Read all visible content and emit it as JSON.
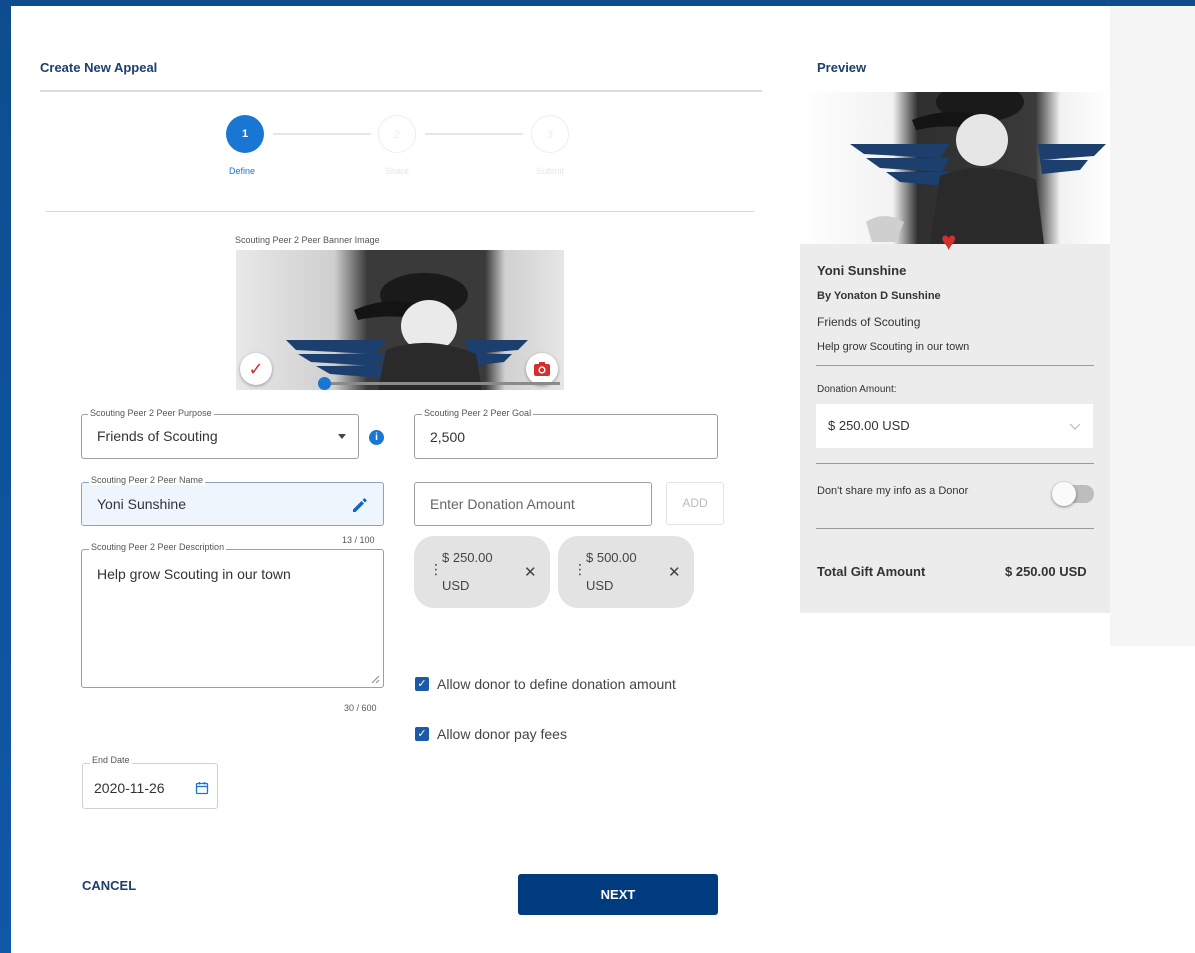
{
  "form": {
    "title": "Create New Appeal",
    "steps": [
      {
        "number": "1",
        "label": "Define",
        "active": true
      },
      {
        "number": "2",
        "label": "Share",
        "active": false
      },
      {
        "number": "3",
        "label": "Submit",
        "active": false
      }
    ],
    "banner": {
      "label": "Scouting Peer 2 Peer Banner Image"
    },
    "purpose": {
      "label": "Scouting Peer 2 Peer Purpose",
      "value": "Friends of Scouting"
    },
    "goal": {
      "label": "Scouting Peer 2 Peer Goal",
      "value": "2,500"
    },
    "name": {
      "label": "Scouting Peer 2 Peer Name",
      "value": "Yoni Sunshine",
      "counter": "13 / 100"
    },
    "description": {
      "label": "Scouting Peer 2 Peer Description",
      "value": "Help grow Scouting in our town",
      "counter": "30 / 600"
    },
    "donation_input": {
      "placeholder": "Enter Donation Amount",
      "add_label": "ADD"
    },
    "chips": [
      {
        "amount": "$ 250.00",
        "currency": "USD"
      },
      {
        "amount": "$ 500.00",
        "currency": "USD"
      }
    ],
    "checkboxes": [
      {
        "label": "Allow donor to define donation amount",
        "checked": true
      },
      {
        "label": "Allow donor pay fees",
        "checked": true
      }
    ],
    "end_date": {
      "label": "End Date",
      "value": "2020-11-26"
    },
    "cancel_label": "CANCEL",
    "next_label": "NEXT"
  },
  "preview": {
    "title": "Preview",
    "appeal_name": "Yoni Sunshine",
    "by_line": "By Yonaton D Sunshine",
    "purpose": "Friends of Scouting",
    "description": "Help grow Scouting in our town",
    "donation_label": "Donation Amount:",
    "donation_value": "$ 250.00 USD",
    "share_label": "Don't share my info as a Donor",
    "share_on": false,
    "total_label": "Total Gift Amount",
    "total_value": "$ 250.00 USD"
  },
  "colors": {
    "primary": "#1976d2",
    "navy": "#003b80",
    "accent_red": "#d32f2f",
    "title": "#1c3f6e"
  }
}
